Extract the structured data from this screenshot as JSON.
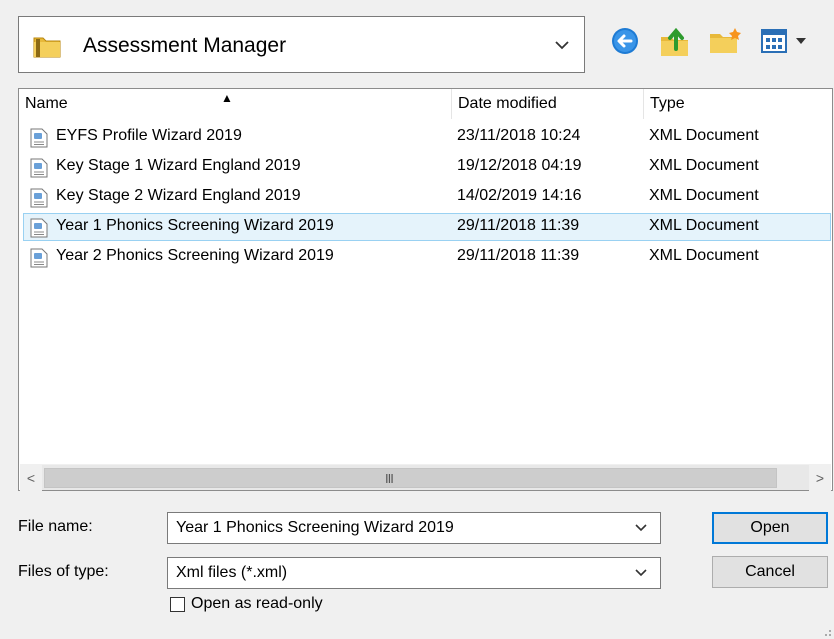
{
  "look_in": {
    "value": "Assessment Manager",
    "icon": "folder-icon"
  },
  "toolbar": {
    "back_icon": "back-arrow-icon",
    "up_icon": "up-folder-icon",
    "new_folder_icon": "new-folder-icon",
    "view_menu_icon": "view-menu-icon"
  },
  "list": {
    "columns": [
      "Name",
      "Date modified",
      "Type"
    ],
    "sort_indicator": "▲",
    "rows": [
      {
        "name": "EYFS Profile Wizard 2019",
        "date": "23/11/2018 10:24",
        "type": "XML Document",
        "selected": false
      },
      {
        "name": "Key Stage 1 Wizard England 2019",
        "date": "19/12/2018 04:19",
        "type": "XML Document",
        "selected": false
      },
      {
        "name": "Key Stage 2 Wizard England 2019",
        "date": "14/02/2019 14:16",
        "type": "XML Document",
        "selected": false
      },
      {
        "name": "Year 1 Phonics Screening Wizard 2019",
        "date": "29/11/2018 11:39",
        "type": "XML Document",
        "selected": true
      },
      {
        "name": "Year 2 Phonics Screening Wizard 2019",
        "date": "29/11/2018 11:39",
        "type": "XML Document",
        "selected": false
      }
    ],
    "scroll_left": "<",
    "scroll_right": ">",
    "scroll_grip": "III"
  },
  "file_name": {
    "label": "File name:",
    "value": "Year 1 Phonics Screening Wizard 2019"
  },
  "file_type": {
    "label": "Files of type:",
    "value": "Xml files (*.xml)"
  },
  "buttons": {
    "open": "Open",
    "cancel": "Cancel"
  },
  "read_only": {
    "label": "Open as read-only",
    "checked": false
  },
  "colors": {
    "selection_bg": "#e5f3fb",
    "selection_border": "#99d1f2",
    "accent": "#0078d7"
  }
}
